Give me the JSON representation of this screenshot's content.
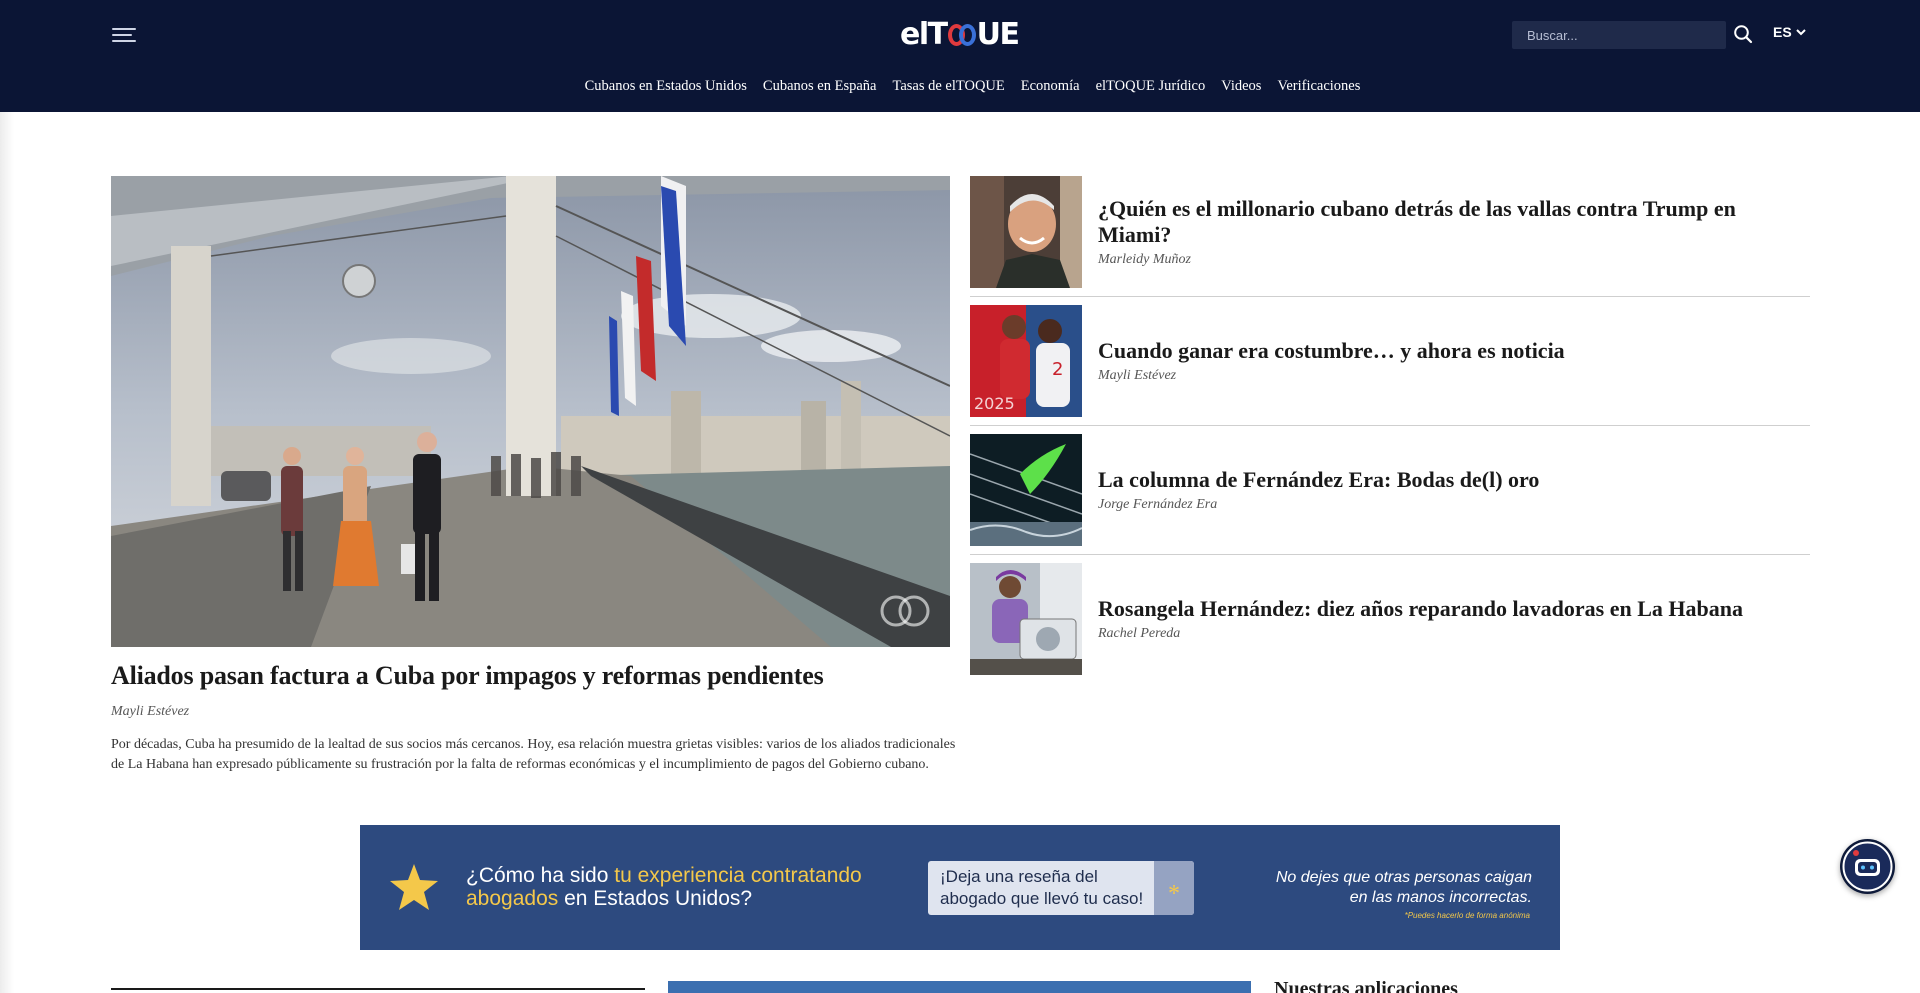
{
  "header": {
    "logo_text": "elTOQUE",
    "search_placeholder": "Buscar...",
    "language": "ES",
    "nav": [
      "Cubanos en Estados Unidos",
      "Cubanos en España",
      "Tasas de elTOQUE",
      "Economía",
      "elTOQUE Jurídico",
      "Videos",
      "Verificaciones"
    ]
  },
  "featured": {
    "title": "Aliados pasan factura a Cuba por impagos y reformas pendientes",
    "author": "Mayli Estévez",
    "excerpt": "Por décadas, Cuba ha presumido de la lealtad de sus socios más cercanos. Hoy, esa relación muestra grietas visibles: varios de los aliados tradicionales de La Habana han expresado públicamente su frustración por la falta de reformas económicas y el incumplimiento de pagos del Gobierno cubano."
  },
  "side_articles": [
    {
      "title": "¿Quién es el millonario cubano detrás de las vallas contra Trump en Miami?",
      "author": "Marleidy Muñoz"
    },
    {
      "title": "Cuando ganar era costumbre… y ahora es noticia",
      "author": "Mayli Estévez"
    },
    {
      "title": "La columna de Fernández Era: Bodas de(l) oro",
      "author": "Jorge Fernández Era"
    },
    {
      "title": "Rosangela Hernández: diez años reparando lavadoras en La Habana",
      "author": "Rachel Pereda"
    }
  ],
  "banner": {
    "q_pre": "¿Cómo ha sido ",
    "q_hl1": "tu experiencia contratando",
    "q_hl2": "abogados",
    "q_post": " en Estados Unidos?",
    "cta": "¡Deja una reseña del abogado que llevó tu caso!",
    "note": "No dejes que otras personas caigan en las manos incorrectas.",
    "small": "*Puedes hacerlo de forma anónima"
  },
  "bottom": {
    "apps_title": "Nuestras aplicaciones"
  },
  "colors": {
    "header_bg": "#0b1535",
    "logo_red": "#e03a3e",
    "logo_blue": "#3a70d8",
    "banner_bg": "#2d4a7f",
    "banner_highlight": "#f4c84a"
  }
}
